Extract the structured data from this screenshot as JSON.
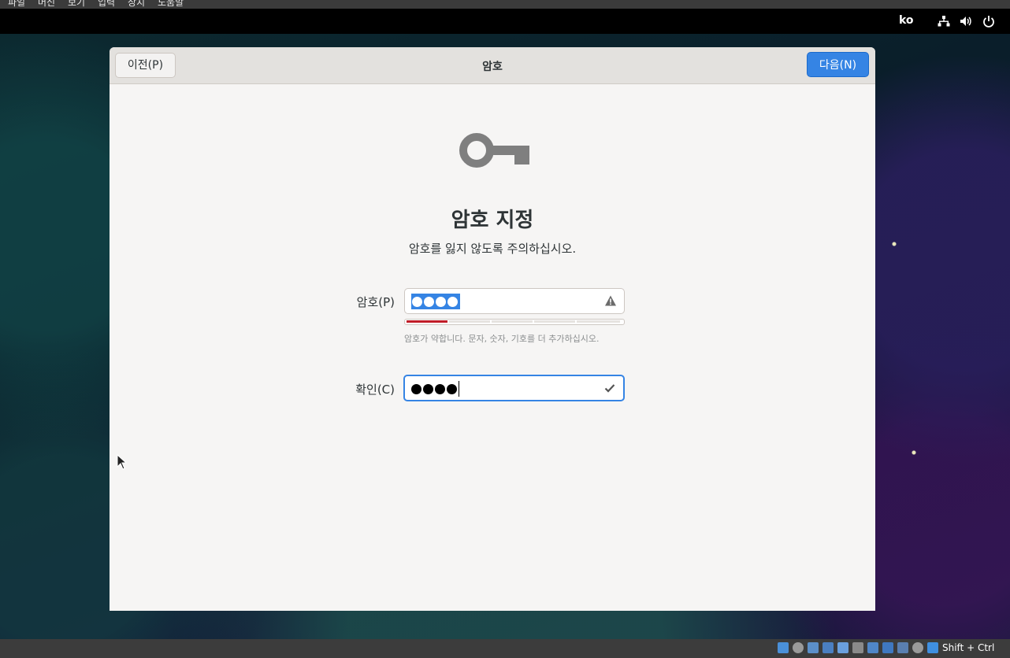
{
  "host_menu": [
    "파일",
    "머신",
    "보기",
    "입력",
    "장치",
    "도움말"
  ],
  "topbar": {
    "lang": "ko",
    "icons": [
      "network-icon",
      "volume-icon",
      "power-icon"
    ]
  },
  "window": {
    "title": "암호",
    "prev_label": "이전(P)",
    "next_label": "다음(N)"
  },
  "page": {
    "icon": "key-icon",
    "heading": "암호 지정",
    "subheading": "암호를 잃지 않도록 주의하십시오."
  },
  "password": {
    "label": "암호(P)",
    "masked_length": 4,
    "status_icon": "warning-icon",
    "strength_level": 0.2,
    "hint": "암호가 약합니다. 문자, 숫자, 기호를 더 추가하십시오."
  },
  "confirm": {
    "label": "확인(C)",
    "masked_length": 4,
    "status_icon": "check-icon"
  },
  "statusbar": {
    "host_key": "Shift + Ctrl"
  },
  "colors": {
    "accent": "#3584e4",
    "weak": "#c01c28"
  }
}
